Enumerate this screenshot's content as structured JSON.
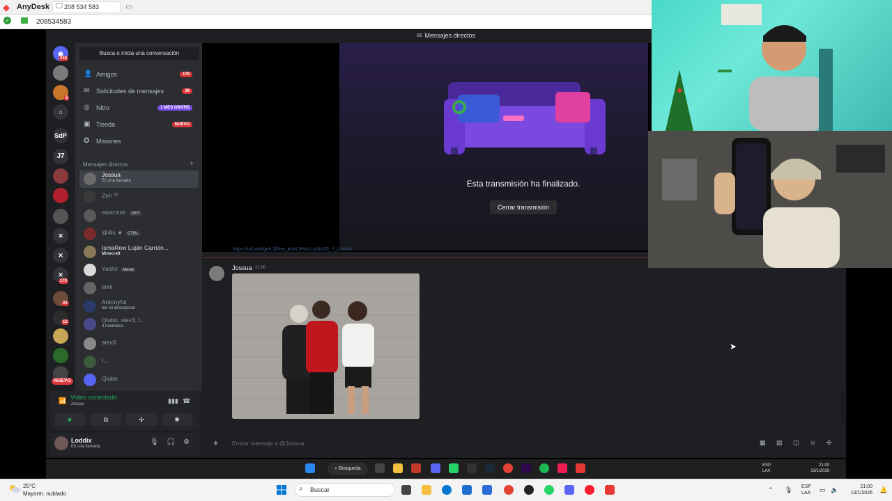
{
  "anydesk": {
    "app_name": "AnyDesk",
    "tab_label": "208 534 583",
    "address_id": "208534583"
  },
  "discord": {
    "topbar_label": "Mensajes directos",
    "search_placeholder": "Busca o inicia una conversación",
    "server_badges": [
      "218",
      "2",
      "J7",
      "SdP",
      "170",
      "23",
      "12",
      "NUEVO"
    ],
    "nav": [
      {
        "icon": "friends-icon",
        "label": "Amigos",
        "badge": "178"
      },
      {
        "icon": "message-requests-icon",
        "label": "Solicitudes de mensajes",
        "badge": "39"
      },
      {
        "icon": "nitro-icon",
        "label": "Nitro",
        "pill": "1 MES GRATIS"
      },
      {
        "icon": "shop-icon",
        "label": "Tienda",
        "pill": "NUEVO"
      },
      {
        "icon": "quests-icon",
        "label": "Misiones"
      }
    ],
    "dm_header": "Mensajes directos",
    "dms": [
      {
        "name": "Jossua",
        "sub": "En una llamada",
        "active": true
      },
      {
        "name": "Zen ᵀᴾ",
        "sub": ""
      },
      {
        "name": "SWAT.EXE",
        "tag": "1907",
        "sub": ""
      },
      {
        "name": "@4lu ★",
        "tag": "CTRL",
        "sub": ""
      },
      {
        "name": "IsmaRow Luján Carrión...",
        "sub": "Minecraft"
      },
      {
        "name": "Yashx",
        "tag": "Meow",
        "sub": ""
      },
      {
        "name": "emii",
        "sub": ""
      },
      {
        "name": "Antonyful",
        "sub": "lee mi descripcion"
      },
      {
        "name": "Qiubo, stev3, I...",
        "sub": "4 miembros"
      },
      {
        "name": "stev3",
        "sub": ""
      },
      {
        "name": "I...",
        "sub": ""
      },
      {
        "name": "Qiubo",
        "sub": ""
      }
    ],
    "voice": {
      "status": "Video conectado",
      "channel": "Jossua"
    },
    "user": {
      "name": "Loddix",
      "status": "En una llamada"
    },
    "stream": {
      "ended_text": "Esta transmisión ha finalizado.",
      "close_label": "Cerrar transmisión"
    },
    "link_preview": "https://url.w/d/geh.3/f/ea_tnzrL3Hrct.cq3u3/3_-f_L-b/u/k",
    "message": {
      "author": "Jossua",
      "time": "21:00"
    },
    "input_placeholder": "Enviar mensaje a @Jossua"
  },
  "remote_taskbar": {
    "search_label": "Búsqueda",
    "lang": "ESP\nLAA",
    "time": "21:00",
    "date": "13/1/2026"
  },
  "local_taskbar": {
    "weather_temp": "25°C",
    "weather_desc": "Mayorm. nublado",
    "search_label": "Buscar",
    "lang_line1": "ESP",
    "lang_line2": "LAA",
    "time": "21:00",
    "date": "13/1/2026"
  },
  "colors": {
    "discord_bg": "#1e1f22",
    "sidebar_bg": "#2b2d31",
    "green": "#23a55a",
    "red_badge": "#da373c",
    "anydesk_red": "#ef443b"
  }
}
